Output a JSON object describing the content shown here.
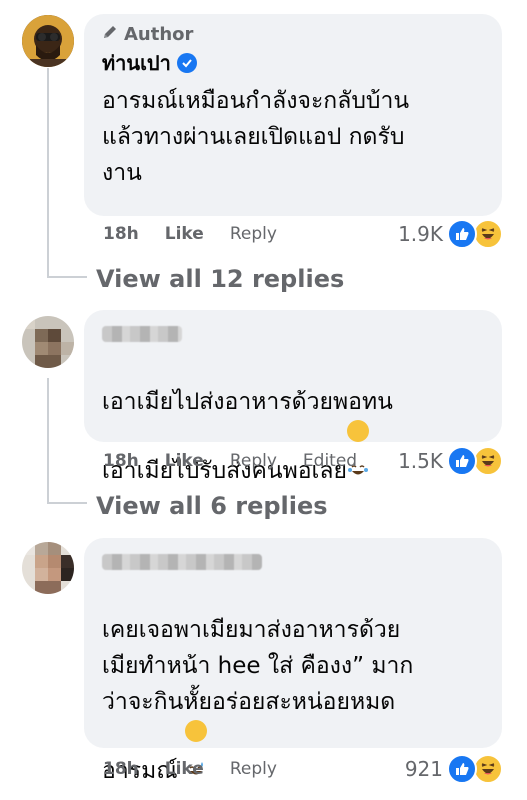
{
  "comments": [
    {
      "badge": "Author",
      "name": "ท่านเปา",
      "text": "อารมณ์เหมือนกำลังจะกลับบ้าน\nแล้วทางผ่านเลยเปิดแอป กดรับ\nงาน",
      "time": "18h",
      "like": "Like",
      "reply": "Reply",
      "count": "1.9K",
      "view_replies": "View all 12 replies"
    },
    {
      "text": "เอาเมียไปส่งอาหารด้วยพอทน\nเอาเมียไปรับส่งคนพอเลย",
      "time": "18h",
      "like": "Like",
      "reply": "Reply",
      "edited": "Edited",
      "count": "1.5K",
      "view_replies": "View all 6 replies"
    },
    {
      "text": "เคยเจอพาเมียมาส่งอาหารด้วย\nเมียทำหน้า hee ใส่ คืองง” มาก\nว่าจะกินหั้ยอร่อยสะหน่อยหมด\nอารมณ์",
      "time": "18h",
      "like": "Like",
      "reply": "Reply",
      "count": "921"
    }
  ],
  "icons": {
    "author": "pencil-icon",
    "verified": "verified-badge-icon",
    "like_reaction": "thumbs-up-icon",
    "haha_reaction": "laughing-face-icon"
  },
  "colors": {
    "bubble": "#f0f2f5",
    "secondary_text": "#65676b",
    "like_blue": "#1877f2",
    "haha_yellow": "#f7c33b"
  }
}
